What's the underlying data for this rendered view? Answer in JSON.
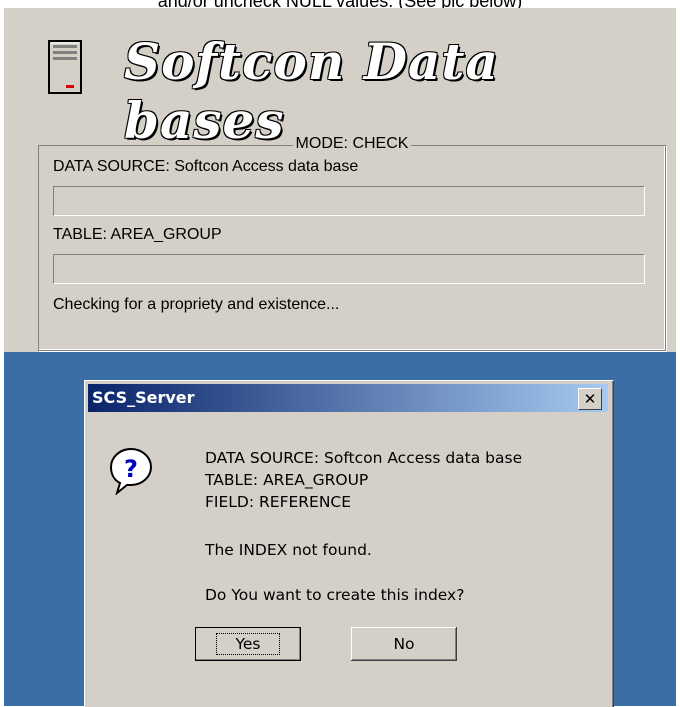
{
  "caption": {
    "text": "and/or uncheck NULL values. (See pic below)"
  },
  "app": {
    "title": "Softcon Data bases",
    "icon": "server-tower-icon",
    "mode_label": "MODE: CHECK",
    "data_source_label": "DATA SOURCE: Softcon Access data base",
    "table_label": "TABLE: AREA_GROUP",
    "status_text": "Checking for a propriety and existence...",
    "progress1": 0,
    "progress2": 0
  },
  "dialog": {
    "title": "SCS_Server",
    "close_glyph": "✕",
    "icon": "question-icon",
    "lines": {
      "data_source": "DATA SOURCE: Softcon Access data base",
      "table": "TABLE: AREA_GROUP",
      "field": "FIELD: REFERENCE",
      "index_msg": "The INDEX not found.",
      "question": "Do You want to create this index?"
    },
    "buttons": {
      "yes": "Yes",
      "no": "No"
    }
  },
  "colors": {
    "panel": "#d4d0c8",
    "desktop": "#3a6ea5",
    "titlebar_start": "#0a246a",
    "titlebar_end": "#a6caf0"
  }
}
